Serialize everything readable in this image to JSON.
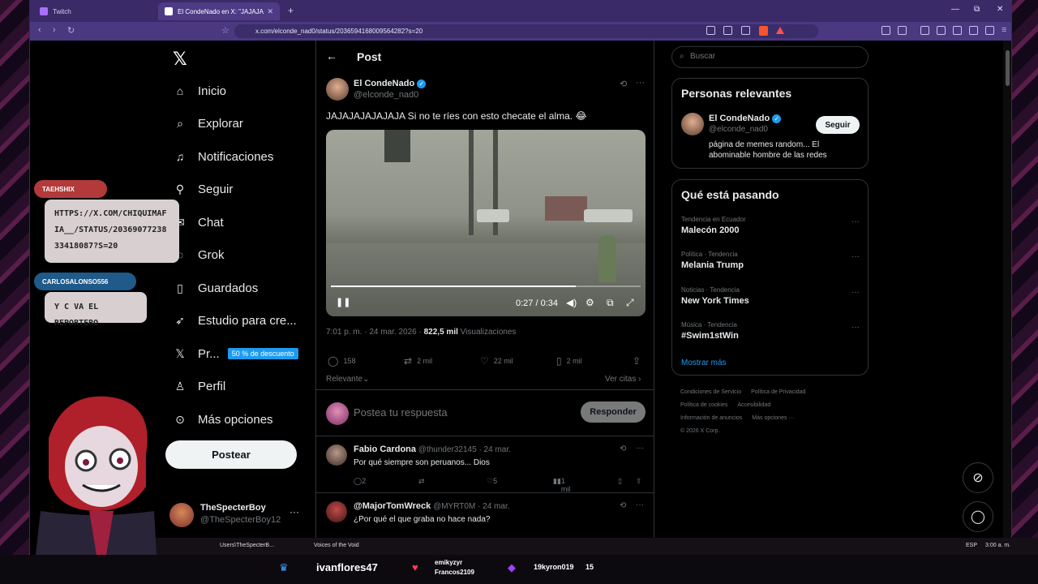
{
  "browser": {
    "tabs": [
      {
        "label": "Twitch"
      },
      {
        "label": "El CondeNado en X: \"JAJAJA"
      }
    ],
    "url": "x.com/elconde_nad0/status/2036594168009564282?s=20",
    "window": {
      "minimize": "—",
      "restore": "⧉",
      "close": "✕"
    }
  },
  "nav": {
    "items": [
      {
        "label": "Inicio",
        "icon": "home-icon"
      },
      {
        "label": "Explorar",
        "icon": "search-icon"
      },
      {
        "label": "Notificaciones",
        "icon": "bell-icon"
      },
      {
        "label": "Seguir",
        "icon": "add-user-icon"
      },
      {
        "label": "Chat",
        "icon": "mail-icon"
      },
      {
        "label": "Grok",
        "icon": "grok-icon"
      },
      {
        "label": "Guardados",
        "icon": "bookmark-icon"
      },
      {
        "label": "Estudio para cre...",
        "icon": "rocket-icon"
      },
      {
        "label": "Pr...",
        "icon": "x-premium-icon"
      },
      {
        "label": "Perfil",
        "icon": "user-icon"
      },
      {
        "label": "Más opciones",
        "icon": "more-icon"
      }
    ],
    "premium_badge": "50 % de descuento",
    "post_button": "Postear",
    "account": {
      "name": "TheSpecterBoy",
      "handle": "@TheSpecterBoy12"
    }
  },
  "post": {
    "header": "Post",
    "author_name": "El CondeNado",
    "author_handle": "@elconde_nad0",
    "text": "JAJAJAJAJAJAJA Si no te ríes con esto checate el alma. 😂",
    "video": {
      "time": "0:27 / 0:34",
      "progress": 0.79
    },
    "timestamp": "7:01 p. m. · 24 mar. 2026 · ",
    "views": "822,5 mil",
    "views_label": " Visualizaciones",
    "stats": {
      "replies": "158",
      "reposts": "2 mil",
      "likes": "22 mil",
      "bookmarks": "2 mil"
    },
    "sort": "Relevante",
    "quotes": "Ver citas",
    "reply_placeholder": "Postea tu respuesta",
    "reply_button": "Responder"
  },
  "replies": [
    {
      "name": "Fabio Cardona",
      "handle": "@thunder32145",
      "date": "· 24 mar.",
      "text": "Por qué siempre son peruanos... Dios",
      "replies": "2",
      "likes": "5",
      "views": "1 mil"
    },
    {
      "name": "@MajorTomWreck",
      "handle": "@MYRT0M",
      "date": "· 24 mar.",
      "text": "¿Por qué el que graba no hace nada?"
    }
  ],
  "search": {
    "placeholder": "Buscar"
  },
  "relevant": {
    "title": "Personas relevantes",
    "name": "El CondeNado",
    "handle": "@elconde_nad0",
    "bio": "página de memes random... El abominable hombre de las redes",
    "follow": "Seguir"
  },
  "trends": {
    "title": "Qué está pasando",
    "items": [
      {
        "context": "Tendencia en Ecuador",
        "name": "Malecón 2000"
      },
      {
        "context": "Política · Tendencia",
        "name": "Melania Trump"
      },
      {
        "context": "Noticias · Tendencia",
        "name": "New York Times"
      },
      {
        "context": "Música · Tendencia",
        "name": "#Swim1stWin"
      }
    ],
    "show_more": "Mostrar más"
  },
  "footer": [
    "Condiciones de Servicio",
    "Política de Privacidad",
    "Política de cookies",
    "Accesibilidad",
    "Información de anuncios",
    "Más opciones ···",
    "© 2026 X Corp."
  ],
  "chat": [
    {
      "user": "TAEHSHIX",
      "message": "HTTPS://X.COM/CHIQUIMAFIA__/STATUS/2036907723833418087?S=20"
    },
    {
      "user": "CARLOSALONSO556",
      "message": "Y C VA EL REPORTERO"
    }
  ],
  "taskbar": {
    "items": [
      "Users\\TheSpecterB...",
      "Voices of the Void"
    ],
    "lang": "ESP",
    "time": "3:00 a. m."
  },
  "stream": {
    "follower": "ivanflores47",
    "gift1": "emikyzyr",
    "gift2": "Francos2109",
    "sub": "19kyron019",
    "sub_count": "15"
  },
  "colors": {
    "accent": "#1d9bf0",
    "browser_chrome": "#3b2a68",
    "background": "#000000"
  }
}
